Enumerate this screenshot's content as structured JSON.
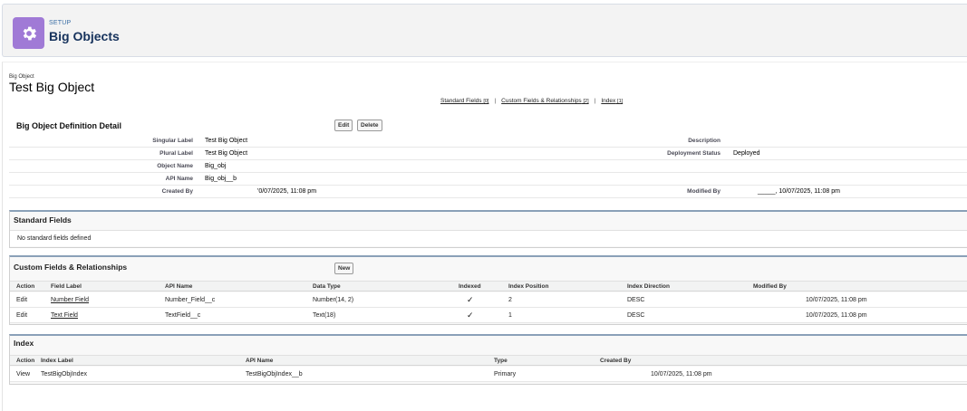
{
  "setup": {
    "kicker": "SETUP",
    "title": "Big Objects",
    "icon": "gear-icon"
  },
  "object": {
    "type_label": "Big Object",
    "title": "Test Big Object"
  },
  "quick_links": [
    {
      "label": "Standard Fields",
      "count": "[0]"
    },
    {
      "label": "Custom Fields & Relationships",
      "count": "[2]"
    },
    {
      "label": "Index",
      "count": "[1]"
    }
  ],
  "detail": {
    "title": "Big Object Definition Detail",
    "edit_label": "Edit",
    "delete_label": "Delete",
    "fields": {
      "singular_label": {
        "label": "Singular Label",
        "value": "Test Big Object"
      },
      "plural_label": {
        "label": "Plural Label",
        "value": "Test Big Object"
      },
      "object_name": {
        "label": "Object Name",
        "value": "Big_obj"
      },
      "api_name": {
        "label": "API Name",
        "value": "Big_obj__b"
      },
      "created_by": {
        "label": "Created By",
        "value": "'0/07/2025, 11:08 pm"
      },
      "description": {
        "label": "Description",
        "value": ""
      },
      "deployment_status": {
        "label": "Deployment Status",
        "value": "Deployed"
      },
      "modified_by": {
        "label": "Modified By",
        "value": "_____, 10/07/2025, 11:08 pm"
      }
    }
  },
  "standard_fields": {
    "title": "Standard Fields",
    "empty_text": "No standard fields defined"
  },
  "custom_fields": {
    "title": "Custom Fields & Relationships",
    "new_label": "New",
    "columns": [
      "Action",
      "Field Label",
      "API Name",
      "Data Type",
      "Indexed",
      "Index Position",
      "Index Direction",
      "Modified By"
    ],
    "rows": [
      {
        "action": "Edit",
        "field_label": "Number Field",
        "api_name": "Number_Field__c",
        "data_type": "Number(14, 2)",
        "indexed": "✓",
        "index_position": "2",
        "index_direction": "DESC",
        "modified_by": "10/07/2025, 11:08 pm"
      },
      {
        "action": "Edit",
        "field_label": "Text Field",
        "api_name": "TextField__c",
        "data_type": "Text(18)",
        "indexed": "✓",
        "index_position": "1",
        "index_direction": "DESC",
        "modified_by": "10/07/2025, 11:08 pm"
      }
    ]
  },
  "index": {
    "title": "Index",
    "columns": [
      "Action",
      "Index Label",
      "API Name",
      "Type",
      "Created By"
    ],
    "rows": [
      {
        "action": "View",
        "index_label": "TestBigObjIndex",
        "api_name": "TestBigObjIndex__b",
        "type": "Primary",
        "created_by": "10/07/2025, 11:08 pm"
      }
    ]
  },
  "colors": {
    "setup_icon_bg": "#a07ad6",
    "link": "#015ba7",
    "section_border": "#8aa0b8"
  }
}
